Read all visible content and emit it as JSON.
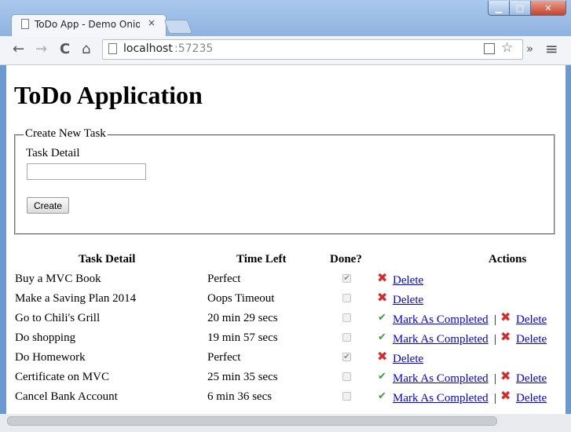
{
  "browser": {
    "tab_title": "ToDo App - Demo Onion",
    "tab_close": "×",
    "url_host": "localhost",
    "url_port": ":57235",
    "window_min": "▁",
    "window_max": "□",
    "window_close": "✕",
    "back": "←",
    "forward": "→",
    "reload": "C",
    "home": "⌂",
    "extensions": "»",
    "menu": "≡"
  },
  "page": {
    "title": "ToDo Application",
    "create_legend": "Create New Task",
    "task_detail_label": "Task Detail",
    "task_detail_value": "",
    "create_button": "Create"
  },
  "table": {
    "headers": [
      "Task Detail",
      "Time Left",
      "Done?",
      "Actions"
    ],
    "mark_completed_label": "Mark As Completed",
    "delete_label": "Delete",
    "separator": "|",
    "rows": [
      {
        "detail": "Buy a MVC Book",
        "time_left": "Perfect",
        "done": true
      },
      {
        "detail": "Make a Saving Plan 2014",
        "time_left": "Oops Timeout",
        "done": false
      },
      {
        "detail": "Go to Chili's Grill",
        "time_left": "20 min 29 secs",
        "done": false
      },
      {
        "detail": "Do shopping",
        "time_left": "19 min 57 secs",
        "done": false
      },
      {
        "detail": "Do Homework",
        "time_left": "Perfect",
        "done": true
      },
      {
        "detail": "Certificate on MVC",
        "time_left": "25 min 35 secs",
        "done": false
      },
      {
        "detail": "Cancel Bank Account",
        "time_left": "6 min 36 secs",
        "done": false
      }
    ]
  },
  "colors": {
    "delete_icon": "#d62b2b",
    "check_icon": "#3f9a3a",
    "link": "#0000ee"
  }
}
